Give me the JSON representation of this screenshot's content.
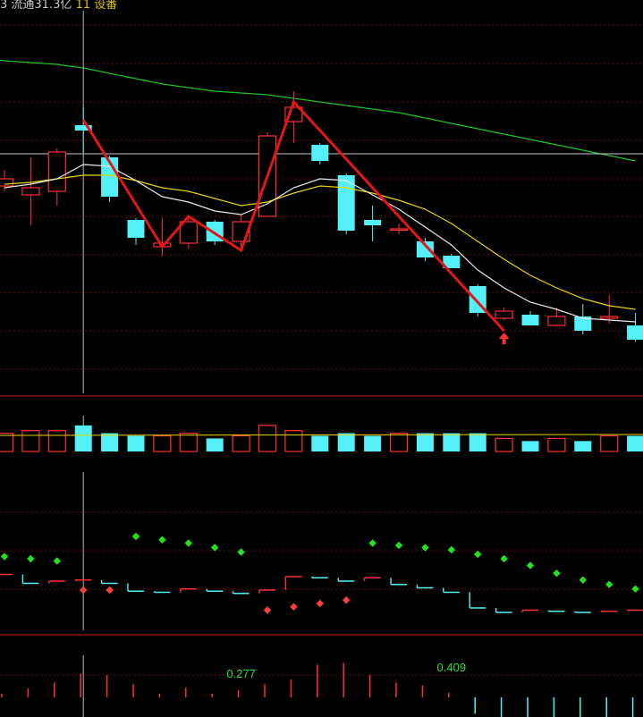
{
  "header": {
    "title_text": "3 流通31.3亿 ",
    "title_accent": "11 设番"
  },
  "colors": {
    "up": "#ff3030",
    "down": "#54f0f8",
    "ma_short": "#e8e8e8",
    "ma_mid": "#e6d400",
    "ma_long": "#22c022",
    "zigzag": "#e01818",
    "signal_up": "#ff3030",
    "sar_up": "#ff4040",
    "sar_down": "#22e022",
    "grid": "#6a1010",
    "divider": "#a01818"
  },
  "chart_data": [
    {
      "type": "candlestick",
      "panel": "price",
      "candles": [
        {
          "o": 41,
          "c": 45,
          "h": 50,
          "l": 38
        },
        {
          "o": 36,
          "c": 40,
          "h": 57,
          "l": 19
        },
        {
          "o": 38,
          "c": 60,
          "h": 62,
          "l": 30
        },
        {
          "o": 75,
          "c": 72,
          "h": 85,
          "l": 60
        },
        {
          "o": 57,
          "c": 35,
          "h": 58,
          "l": 32
        },
        {
          "o": 22,
          "c": 12,
          "h": 23,
          "l": 8
        },
        {
          "o": 7,
          "c": 9,
          "h": 23,
          "l": 2
        },
        {
          "o": 9,
          "c": 21,
          "h": 23,
          "l": 6
        },
        {
          "o": 21,
          "c": 10,
          "h": 22,
          "l": 8
        },
        {
          "o": 10,
          "c": 21,
          "h": 25,
          "l": 5
        },
        {
          "o": 24,
          "c": 69,
          "h": 71,
          "l": 24
        },
        {
          "o": 77,
          "c": 85,
          "h": 94,
          "l": 65
        },
        {
          "o": 64,
          "c": 55,
          "h": 65,
          "l": 53
        },
        {
          "o": 47,
          "c": 16,
          "h": 48,
          "l": 14
        },
        {
          "o": 22,
          "c": 19,
          "h": 30,
          "l": 10
        },
        {
          "o": 17,
          "c": 17,
          "h": 20,
          "l": 14
        },
        {
          "o": 10,
          "c": 1,
          "h": 12,
          "l": -1
        },
        {
          "o": 2,
          "c": -5,
          "h": 3,
          "l": -5
        },
        {
          "o": -15,
          "c": -30,
          "h": -14,
          "l": -32
        },
        {
          "o": -33,
          "c": -29,
          "h": -27,
          "l": -34
        },
        {
          "o": -31,
          "c": -37,
          "h": -29,
          "l": -37
        },
        {
          "o": -37,
          "c": -32,
          "h": -27,
          "l": -37
        },
        {
          "o": -32,
          "c": -40,
          "h": -25,
          "l": -42
        },
        {
          "o": -33,
          "c": -32,
          "h": -20,
          "l": -36
        },
        {
          "o": -37,
          "c": -45,
          "h": -30,
          "l": -46
        }
      ],
      "ma_short": [
        40,
        42,
        45,
        53,
        52,
        44,
        35,
        32,
        27,
        25,
        31,
        40,
        45,
        44,
        36,
        28,
        18,
        8,
        -6,
        -16,
        -24,
        -28,
        -33,
        -34,
        -35
      ],
      "ma_mid": [
        42,
        43,
        45,
        47,
        47,
        44,
        40,
        38,
        34,
        30,
        32,
        37,
        41,
        40,
        37,
        33,
        28,
        20,
        10,
        0,
        -9,
        -16,
        -22,
        -26,
        -28
      ],
      "ma_long": [
        111,
        110,
        109,
        107,
        104,
        101,
        98,
        96,
        94,
        93,
        92,
        90,
        88,
        86,
        84,
        82,
        79,
        76,
        73,
        70,
        67,
        64,
        61,
        58,
        55
      ],
      "zigzag": [
        [
          3,
          78
        ],
        [
          6,
          7
        ],
        [
          7,
          24
        ],
        [
          9,
          5
        ],
        [
          11,
          88
        ],
        [
          19,
          -40
        ]
      ],
      "signal_arrow_index": 19,
      "horizontal_line": 59,
      "cursor_index": 3,
      "ylim": [
        -75,
        145
      ]
    },
    {
      "type": "bar",
      "panel": "volume",
      "values": [
        7,
        8,
        8,
        10,
        7,
        6,
        6,
        7,
        5,
        6,
        10,
        8,
        6,
        7,
        6,
        7,
        7,
        7,
        7,
        5,
        4,
        5,
        4,
        6,
        6
      ],
      "ylim": [
        0,
        12
      ]
    },
    {
      "type": "scatter",
      "panel": "indicator",
      "steps": [
        -4,
        -12,
        -10,
        -9,
        -12,
        -19,
        -20,
        -17,
        -19,
        -21,
        -18,
        -6,
        -7,
        -10,
        -7,
        -13,
        -16,
        -20,
        -34,
        -38,
        -36,
        -37,
        -38,
        -37,
        -36
      ],
      "sar_up": [
        {
          "i": 3,
          "v": -18
        },
        {
          "i": 4,
          "v": -18
        },
        {
          "i": 10,
          "v": -36
        },
        {
          "i": 11,
          "v": -33
        },
        {
          "i": 12,
          "v": -30
        },
        {
          "i": 13,
          "v": -27
        }
      ],
      "sar_down": [
        {
          "i": 0,
          "v": 12
        },
        {
          "i": 1,
          "v": 10
        },
        {
          "i": 2,
          "v": 8
        },
        {
          "i": 5,
          "v": 30
        },
        {
          "i": 6,
          "v": 27
        },
        {
          "i": 7,
          "v": 24
        },
        {
          "i": 8,
          "v": 20
        },
        {
          "i": 9,
          "v": 16
        },
        {
          "i": 14,
          "v": 24
        },
        {
          "i": 15,
          "v": 22
        },
        {
          "i": 16,
          "v": 20
        },
        {
          "i": 17,
          "v": 18
        },
        {
          "i": 18,
          "v": 14
        },
        {
          "i": 19,
          "v": 10
        },
        {
          "i": 20,
          "v": 4
        },
        {
          "i": 21,
          "v": -3
        },
        {
          "i": 22,
          "v": -9
        },
        {
          "i": 23,
          "v": -13
        },
        {
          "i": 24,
          "v": -17
        }
      ],
      "ylim": [
        -50,
        50
      ]
    },
    {
      "type": "bar",
      "panel": "histogram",
      "values": [
        0.05,
        0.12,
        0.2,
        0.32,
        0.3,
        0.18,
        0.05,
        0.13,
        0.05,
        0.1,
        0.18,
        0.24,
        0.44,
        0.46,
        0.3,
        0.2,
        0.16,
        0.06,
        -0.22,
        -0.4,
        -0.42,
        -0.44,
        -0.42,
        -0.44,
        -0.46
      ],
      "labels": [
        {
          "i": 9,
          "text": "0.277"
        },
        {
          "i": 17,
          "text": "0.409"
        }
      ],
      "ylim": [
        -0.6,
        0.6
      ]
    }
  ]
}
